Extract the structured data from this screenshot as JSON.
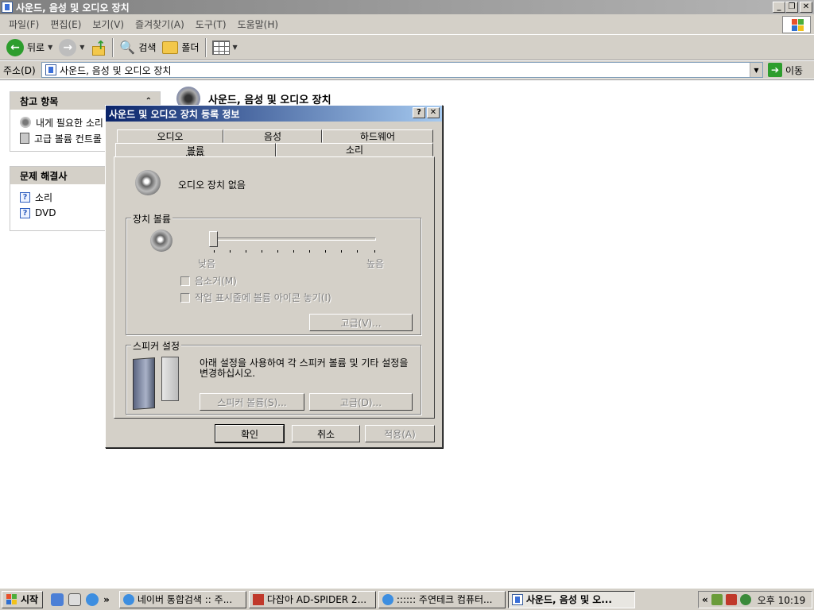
{
  "window": {
    "title": "사운드, 음성 및 오디오 장치",
    "controls": {
      "minimize": "_",
      "maximize": "❐",
      "close": "✕"
    }
  },
  "menu": [
    "파일(F)",
    "편집(E)",
    "보기(V)",
    "즐겨찾기(A)",
    "도구(T)",
    "도움말(H)"
  ],
  "toolbar": {
    "back": "뒤로",
    "search": "검색",
    "folders": "폴더"
  },
  "address": {
    "label": "주소(D)",
    "value": "사운드, 음성 및 오디오 장치",
    "go": "이동"
  },
  "sidebar": {
    "see_also": {
      "title": "참고 항목",
      "items": [
        "내게 필요한 소리",
        "고급 볼륨 컨트롤"
      ]
    },
    "troubleshooters": {
      "title": "문제 해결사",
      "items": [
        "소리",
        "DVD"
      ]
    }
  },
  "page_heading": "사운드, 음성 및 오디오 장치",
  "dialog": {
    "title": "사운드 및 오디오 장치 등록 정보",
    "help": "?",
    "close": "✕",
    "tabs_back": [
      "오디오",
      "음성",
      "하드웨어"
    ],
    "tabs_front": [
      "볼륨",
      "소리"
    ],
    "active_tab": "볼륨",
    "device_label": "오디오 장치 없음",
    "device_volume": {
      "title": "장치 볼륨",
      "low": "낮음",
      "high": "높음",
      "level": 0,
      "mute": "음소거(M)",
      "tray_icon": "작업 표시줄에 볼륨 아이콘 놓기(I)",
      "advanced": "고급(V)..."
    },
    "speaker_settings": {
      "title": "스피커 설정",
      "description": "아래 설정을 사용하여 각 스피커 볼륨 및 기타 설정을 변경하십시오.",
      "speaker_volume": "스피커 볼륨(S)...",
      "advanced": "고급(D)..."
    },
    "buttons": {
      "ok": "확인",
      "cancel": "취소",
      "apply": "적용(A)"
    }
  },
  "taskbar": {
    "start": "시작",
    "more": "»",
    "tasks": [
      "네이버 통합검색 :: 주...",
      "다잡아 AD-SPIDER 2...",
      ":::::: 주연테크 컴퓨터...",
      "사운드, 음성 및 오..."
    ],
    "tray_chevron": "«",
    "clock": "오후 10:19"
  },
  "colors": {
    "face": "#d4d0c8",
    "title_active": "#0a246a",
    "title_inactive": "#808080",
    "accent_green": "#2d9d2d"
  }
}
